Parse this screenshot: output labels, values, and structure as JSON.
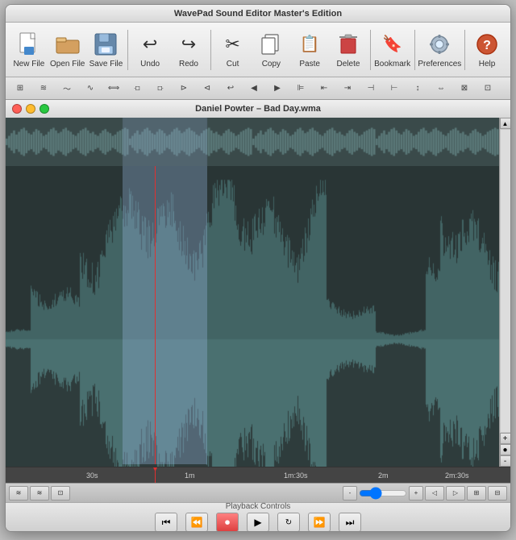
{
  "window": {
    "title": "WavePad Sound Editor Master's Edition",
    "file_title": "Daniel Powter – Bad Day.wma"
  },
  "toolbar": {
    "buttons": [
      {
        "id": "new-file",
        "label": "New File",
        "icon": "📄"
      },
      {
        "id": "open-file",
        "label": "Open File",
        "icon": "📂"
      },
      {
        "id": "save-file",
        "label": "Save File",
        "icon": "💾"
      },
      {
        "id": "undo",
        "label": "Undo",
        "icon": "↩"
      },
      {
        "id": "redo",
        "label": "Redo",
        "icon": "↪"
      },
      {
        "id": "cut",
        "label": "Cut",
        "icon": "✂"
      },
      {
        "id": "copy",
        "label": "Copy",
        "icon": "⿻"
      },
      {
        "id": "paste",
        "label": "Paste",
        "icon": "📋"
      },
      {
        "id": "delete",
        "label": "Delete",
        "icon": "🗑"
      },
      {
        "id": "bookmark",
        "label": "Bookmark",
        "icon": "🔖"
      },
      {
        "id": "preferences",
        "label": "Preferences",
        "icon": "⚙"
      },
      {
        "id": "help",
        "label": "Help",
        "icon": "?"
      }
    ]
  },
  "timeline": {
    "markers": [
      "30s",
      "1m",
      "1m:30s",
      "2m",
      "2m:30s"
    ]
  },
  "playback": {
    "label": "Playback Controls",
    "buttons": [
      {
        "id": "skip-start",
        "icon": "⏮"
      },
      {
        "id": "rewind",
        "icon": "⏪"
      },
      {
        "id": "record",
        "icon": "⏺"
      },
      {
        "id": "play",
        "icon": "▶"
      },
      {
        "id": "loop",
        "icon": "🔁"
      },
      {
        "id": "fast-forward",
        "icon": "⏩"
      },
      {
        "id": "skip-end",
        "icon": "⏭"
      }
    ]
  },
  "colors": {
    "waveform_bg": "#2e3c3c",
    "waveform_color": "#4a7070",
    "selection_color": "rgba(150,180,220,0.35)",
    "cursor_color": "#e03030",
    "timeline_bg": "#444444"
  }
}
